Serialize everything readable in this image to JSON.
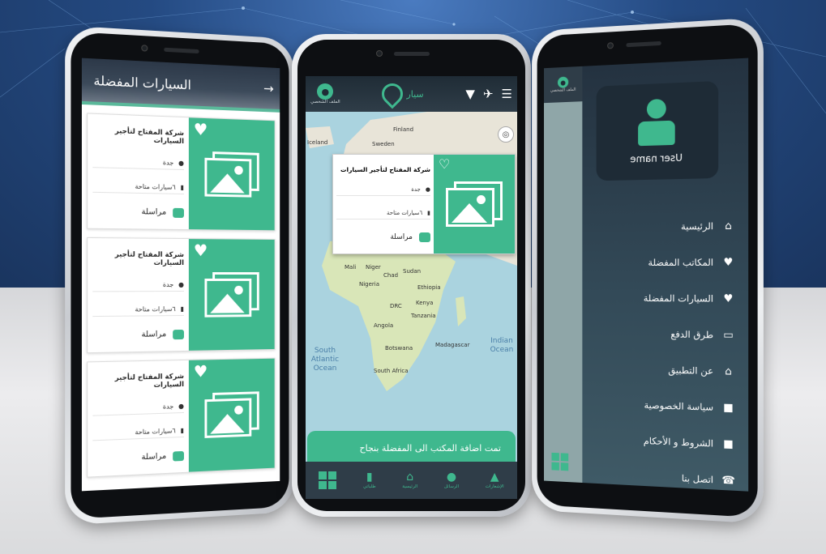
{
  "left_screen": {
    "title": "السيارات المفضلة",
    "back_icon": "arrow-right-icon",
    "cards": [
      {
        "company": "شركة المفتاح لتأجير السيارات",
        "city": "جدة",
        "cars": "٦سيارات متاحة",
        "message": "مراسلة"
      },
      {
        "company": "شركة المفتاح لتأجير السيارات",
        "city": "جدة",
        "cars": "٦سيارات متاحة",
        "message": "مراسلة"
      },
      {
        "company": "شركة المفتاح لتأجير السيارات",
        "city": "جدة",
        "cars": "٦سيارات متاحة",
        "message": "مراسلة"
      }
    ]
  },
  "center_screen": {
    "profile_label": "الملف الشخصي",
    "logo_text": "سيار",
    "map_labels": {
      "finland": "Finland",
      "sweden": "Sweden",
      "iceland": "Iceland",
      "mali": "Mali",
      "niger": "Niger",
      "chad": "Chad",
      "sudan": "Sudan",
      "nigeria": "Nigeria",
      "ethiopia": "Ethiopia",
      "drc": "DRC",
      "kenya": "Kenya",
      "tanzania": "Tanzania",
      "angola": "Angola",
      "madagascar": "Madagascar",
      "botswana": "Botswana",
      "south_africa": "South Africa",
      "south_atlantic": "South Atlantic Ocean",
      "indian_ocean": "Indian Ocean"
    },
    "popup": {
      "company": "شركة المفتاح لتأجير السيارات",
      "city": "جدة",
      "cars": "٦سيارات متاحة",
      "message": "مراسلة"
    },
    "toast": "تمت اضافة المكتب الى المفضلة بنجاح",
    "nav": [
      {
        "label": "",
        "icon": "grid-icon"
      },
      {
        "label": "طلباتي",
        "icon": "orders-icon"
      },
      {
        "label": "الرئيسية",
        "icon": "home-icon"
      },
      {
        "label": "الرسائل",
        "icon": "chat-icon"
      },
      {
        "label": "الإشعارات",
        "icon": "bell-icon"
      }
    ]
  },
  "right_screen": {
    "drawer_map_label": "الملف الشخصي",
    "username": "User name",
    "menu": [
      {
        "label": "الرئيسية",
        "icon": "home-icon"
      },
      {
        "label": "المكاتب المفضلة",
        "icon": "heart-icon"
      },
      {
        "label": "السيارات المفضلة",
        "icon": "heart-icon"
      },
      {
        "label": "طرق الدفع",
        "icon": "payment-icon"
      },
      {
        "label": "عن التطبيق",
        "icon": "home-icon"
      },
      {
        "label": "سياسة الخصوصية",
        "icon": "lock-icon"
      },
      {
        "label": "الشروط و الأحكام",
        "icon": "lock-icon"
      },
      {
        "label": "اتصل بنا",
        "icon": "phone-icon"
      }
    ]
  },
  "colors": {
    "accent": "#3fb88e",
    "dark": "#2f3d48",
    "background_top": "#244a82"
  }
}
